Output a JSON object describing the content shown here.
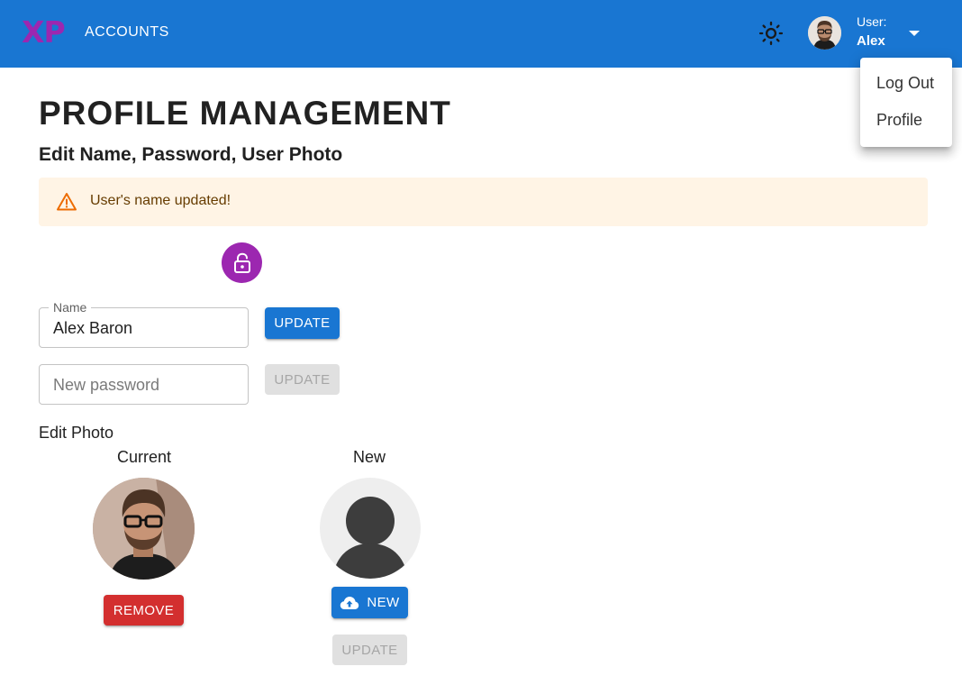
{
  "appbar": {
    "logo": "XP",
    "nav_link": "ACCOUNTS",
    "theme_icon": "sun-icon",
    "user_label": "User:",
    "user_name": "Alex",
    "caret_icon": "caret-down-icon",
    "background": "#1976d2",
    "logo_color": "#9c27b0"
  },
  "user_menu": {
    "items": [
      {
        "label": "Log Out"
      },
      {
        "label": "Profile"
      }
    ]
  },
  "page": {
    "title": "PROFILE MANAGEMENT",
    "subtitle": "Edit Name, Password, User Photo"
  },
  "alert": {
    "icon": "warning-triangle-icon",
    "message": "User's name updated!",
    "background": "#fff4e5",
    "icon_color": "#ed6c02"
  },
  "lock": {
    "icon": "lock-open-icon",
    "background": "#9c27b0"
  },
  "name_field": {
    "label": "Name",
    "value": "Alex Baron",
    "button_label": "UPDATE"
  },
  "password_field": {
    "placeholder": "New password",
    "button_label": "UPDATE"
  },
  "photo": {
    "section_label": "Edit Photo",
    "current_label": "Current",
    "new_label": "New",
    "remove_label": "REMOVE",
    "new_button_label": "NEW",
    "upload_icon": "cloud-upload-icon",
    "update_label": "UPDATE"
  }
}
